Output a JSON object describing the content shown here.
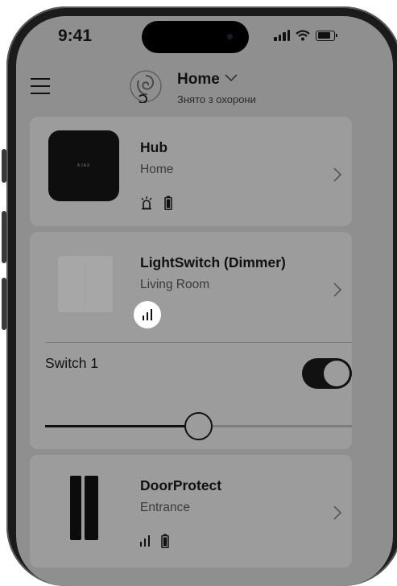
{
  "status_bar": {
    "time": "9:41"
  },
  "header": {
    "title": "Home",
    "subtitle": "Знято з охорони"
  },
  "devices": [
    {
      "name": "Hub",
      "room": "Home",
      "image_text": "AJAX"
    },
    {
      "name": "LightSwitch (Dimmer)",
      "room": "Living Room"
    },
    {
      "name": "DoorProtect",
      "room": "Entrance"
    }
  ],
  "dimmer": {
    "switch_label": "Switch 1",
    "toggle_on": true,
    "brightness_percent": 50
  },
  "colors": {
    "card_bg": "#9c9c9c",
    "screen_overlay": "#8f8f8f",
    "toggle_on": "#111111"
  }
}
